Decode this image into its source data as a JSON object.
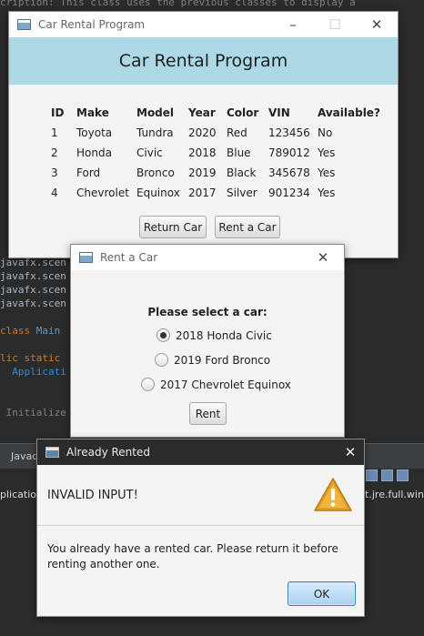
{
  "ide": {
    "code_lines": [
      {
        "prefix": "cription: This class uses the previous classes to display a",
        "highlight": "",
        "suffix": ""
      },
      {
        "prefix": "javafx.scen",
        "highlight": "",
        "suffix": ""
      },
      {
        "prefix": "javafx.scen",
        "highlight": "",
        "suffix": ""
      },
      {
        "prefix": "javafx.scen",
        "highlight": "",
        "suffix": ""
      },
      {
        "prefix": "javafx.scen",
        "highlight": "",
        "suffix": ""
      },
      {
        "prefix": "",
        "highlight": "class",
        "suffix": " Main"
      },
      {
        "prefix": "",
        "highlight": "lic static",
        "suffix": ""
      },
      {
        "prefix": "  ",
        "highlight": "Applicati",
        "suffix": ""
      },
      {
        "prefix": " Initialize",
        "highlight": "",
        "suffix": ""
      }
    ],
    "javadoc_tab": "Javad",
    "console_left": "plicatio",
    "console_right": "it.jre.full.win"
  },
  "main_window": {
    "title": "Car Rental Program",
    "header": "Car Rental Program",
    "columns": [
      "ID",
      "Make",
      "Model",
      "Year",
      "Color",
      "VIN",
      "Available?"
    ],
    "rows": [
      [
        "1",
        "Toyota",
        "Tundra",
        "2020",
        "Red",
        "123456",
        "No"
      ],
      [
        "2",
        "Honda",
        "Civic",
        "2018",
        "Blue",
        "789012",
        "Yes"
      ],
      [
        "3",
        "Ford",
        "Bronco",
        "2019",
        "Black",
        "345678",
        "Yes"
      ],
      [
        "4",
        "Chevrolet",
        "Equinox",
        "2017",
        "Silver",
        "901234",
        "Yes"
      ]
    ],
    "return_button": "Return Car",
    "rent_button": "Rent a Car"
  },
  "rent_dialog": {
    "title": "Rent a Car",
    "prompt": "Please select a car:",
    "options": [
      "2018 Honda Civic",
      "2019 Ford Bronco",
      "2017 Chevrolet Equinox"
    ],
    "selected_index": 0,
    "rent_button": "Rent"
  },
  "alert": {
    "title": "Already Rented",
    "header": "INVALID INPUT!",
    "content": "You already have a rented car. Please return it before renting another one.",
    "ok_button": "OK",
    "icon": "warning-icon"
  },
  "colors": {
    "header_bg": "#add8e6",
    "ide_bg": "#2b2b2b",
    "default_button": "#a9d1f2",
    "warning": "#e5a025"
  }
}
